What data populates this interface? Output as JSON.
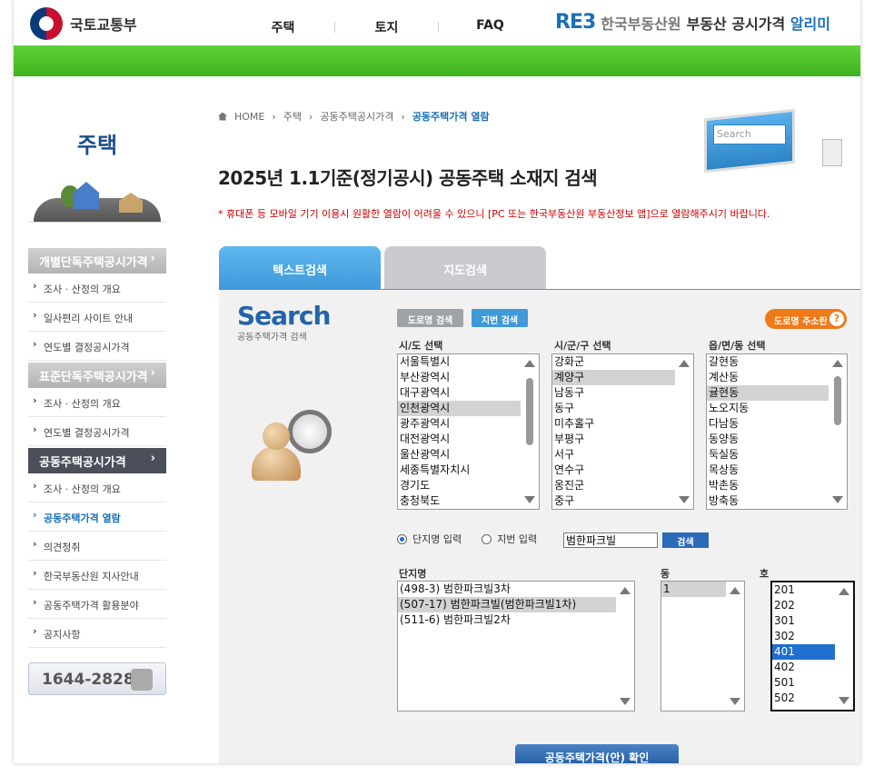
{
  "header": {
    "ministry": "국토교통부",
    "nav": [
      "주택",
      "토지",
      "FAQ"
    ],
    "reb_logo": "RE3",
    "reb_org": "한국부동산원",
    "reb_title_plain": "부동산 공시가격",
    "reb_title_accent": "알리미"
  },
  "sidebar": {
    "title": "주택",
    "sections": [
      {
        "label": "개별단독주택공시가격",
        "arrow": "›",
        "items": [
          "조사 · 산정의 개요",
          "일사편리 사이트 안내",
          "연도별 결정공시가격"
        ]
      },
      {
        "label": "표준단독주택공시가격",
        "arrow": "›",
        "items": [
          "조사 · 산정의 개요",
          "연도별 결정공시가격"
        ]
      },
      {
        "label": "공동주택공시가격",
        "arrow": "›",
        "items": [
          "조사 · 산정의 개요",
          "공동주택가격 열람",
          "의견청취",
          "한국부동산원 지사안내",
          "공동주택가격 활용분야",
          "공지사항"
        ]
      }
    ],
    "phone": "1644-2828"
  },
  "breadcrumb": [
    "HOME",
    "주택",
    "공동주택공시가격",
    "공동주택가격 열람"
  ],
  "page_title": "2025년 1.1기준(정기공시) 공동주택 소재지 검색",
  "notice": "* 휴대폰 등 모바일 기기 이용시 원활한 열람이 어려울 수 있으니 [PC 또는 한국부동산원 부동산정보 앱]으로 열람해주시기 바랍니다.",
  "deco": {
    "search_text": "Search"
  },
  "tabs": [
    "텍스트검색",
    "지도검색"
  ],
  "search_logo": {
    "big": "Search",
    "small": "공동주택가격 검색"
  },
  "buttons": {
    "road": "도로명 검색",
    "jibun": "지번 검색",
    "addr": "도로명 주소란",
    "addr_q": "?",
    "search": "검색",
    "confirm": "공동주택가격(안) 확인"
  },
  "labels": {
    "sido": "시/도 선택",
    "sigungu": "시/군/구 선택",
    "dong": "읍/면/동 선택",
    "danji": "단지명",
    "bldg": "동",
    "ho": "호"
  },
  "lists": {
    "sido": {
      "items": [
        "서울특별시",
        "부산광역시",
        "대구광역시",
        "인천광역시",
        "광주광역시",
        "대전광역시",
        "울산광역시",
        "세종특별자치시",
        "경기도",
        "충청북도"
      ],
      "selected": 3
    },
    "sigungu": {
      "items": [
        "강화군",
        "계양구",
        "남동구",
        "동구",
        "미추홀구",
        "부평구",
        "서구",
        "연수구",
        "옹진군",
        "중구"
      ],
      "selected": 1
    },
    "emd": {
      "items": [
        "갈현동",
        "계산동",
        "귤현동",
        "노오지동",
        "다남동",
        "동양동",
        "둑실동",
        "목상동",
        "박촌동",
        "방축동"
      ],
      "selected": 2
    },
    "danji": {
      "items": [
        "(498-3) 범한파크빌3차",
        "(507-17) 범한파크빌(범한파크빌1차)",
        "(511-6) 범한파크빌2차"
      ],
      "selected": 1
    },
    "bldg": {
      "items": [
        "1"
      ],
      "selected": 0
    },
    "ho": {
      "items": [
        "201",
        "202",
        "301",
        "302",
        "401",
        "402",
        "501",
        "502"
      ],
      "selected": 4
    }
  },
  "radio": {
    "danji": "단지명 입력",
    "jibun": "지번 입력",
    "selected": "danji"
  },
  "query": "범한파크빌"
}
